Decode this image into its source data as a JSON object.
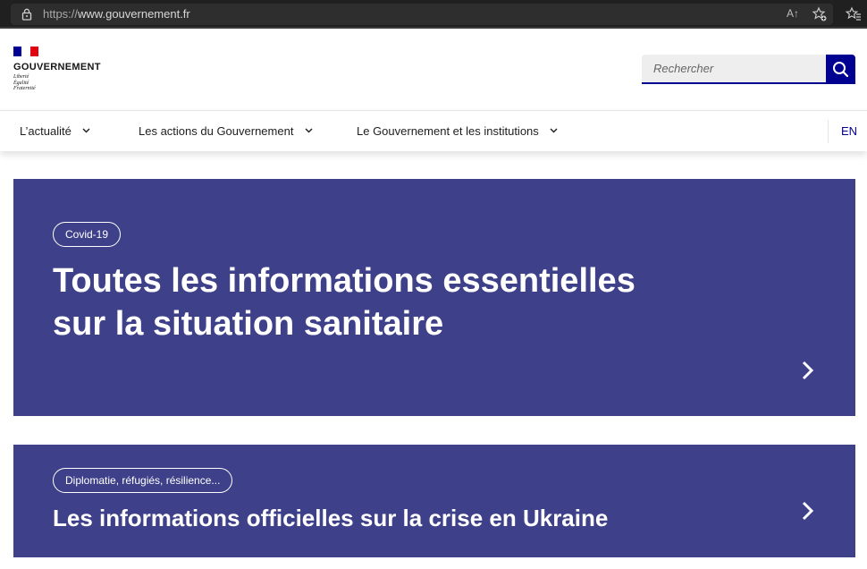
{
  "browser": {
    "url_protocol": "https://",
    "url_host": "www.gouvernement.fr",
    "read_aloud_label": "A↑",
    "icons": [
      "lock-icon",
      "read-aloud-icon",
      "add-favorite-icon",
      "favorites-icon"
    ]
  },
  "header": {
    "logo_title": "GOUVERNEMENT",
    "motto": [
      "Liberté",
      "Égalité",
      "Fraternité"
    ],
    "search_placeholder": "Rechercher",
    "colors": {
      "flag_blue": "#000091",
      "flag_red": "#e1000f"
    }
  },
  "nav": {
    "items": [
      {
        "label": "L’actualité"
      },
      {
        "label": "Les actions du Gouvernement"
      },
      {
        "label": "Le Gouvernement et les institutions"
      }
    ],
    "lang": "EN"
  },
  "cards": [
    {
      "tag": "Covid-19",
      "title": "Toutes les informations essentielles sur la situation sanitaire"
    },
    {
      "tag": "Diplomatie, réfugiés, résilience...",
      "title": "Les informations officielles sur la crise en Ukraine"
    }
  ],
  "colors": {
    "accent": "#000091",
    "card_background": "#3e4189"
  }
}
